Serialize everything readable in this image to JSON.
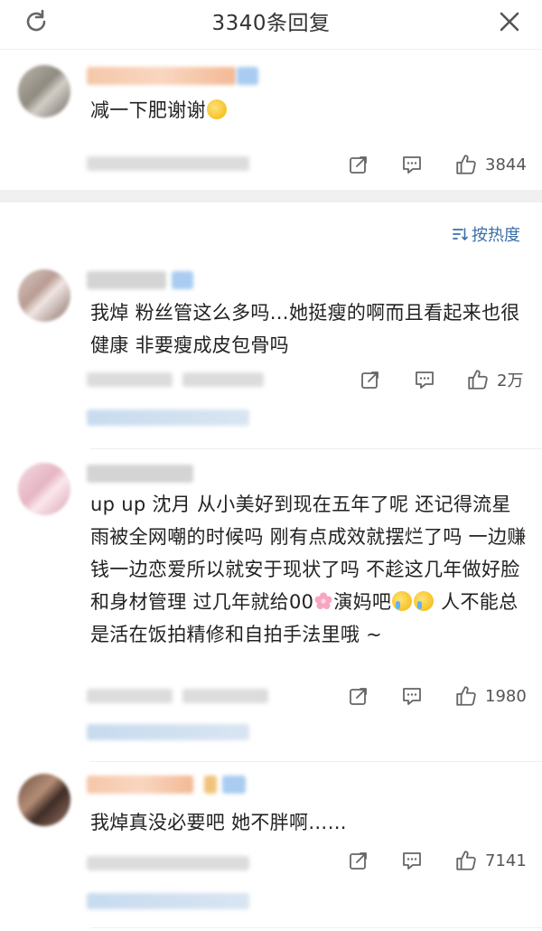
{
  "header": {
    "title": "3340条回复"
  },
  "sort": {
    "label": "按热度"
  },
  "op_comment": {
    "text": "减一下肥谢谢",
    "likes": "3844"
  },
  "comments": [
    {
      "text": "我焯 粉丝管这么多吗…她挺瘦的啊而且看起来也很健康 非要瘦成皮包骨吗",
      "likes": "2万"
    },
    {
      "text_parts": [
        "up up 沈月 从小美好到现在五年了呢 还记得流星雨被全网嘲的时候吗 刚有点成效就摆烂了吗 一边赚钱一边恋爱所以就安于现状了吗 不趁这几年做好脸和身材管理 过几年就给00",
        "演妈吧",
        " 人不能总是活在饭拍精修和自拍手法里哦 ~"
      ],
      "likes": "1980"
    },
    {
      "text": "我焯真没必要吧 她不胖啊……",
      "likes": "7141"
    }
  ],
  "icons": {
    "refresh": "refresh-icon",
    "close": "close-icon",
    "repost": "repost-icon",
    "comment": "comment-icon",
    "like": "thumbs-up-icon",
    "sort": "sort-icon"
  },
  "colors": {
    "accent": "#3a6ea8",
    "divider": "#f0f0f0"
  }
}
